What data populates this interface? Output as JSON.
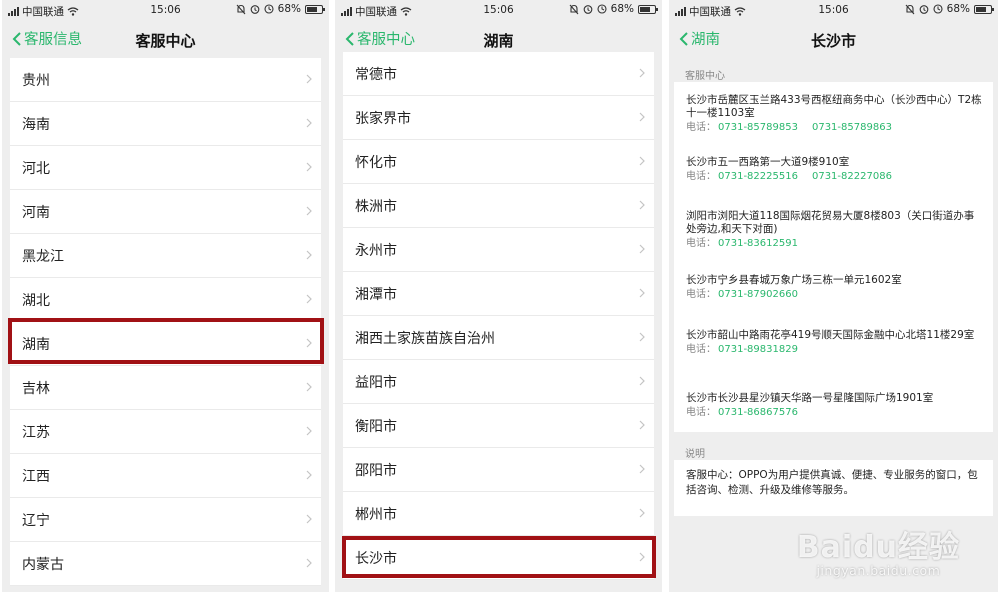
{
  "status": {
    "carrier": "中国联通",
    "time": "15:06",
    "battery": "68%",
    "battery_level": 0.68,
    "icons": [
      "signal-icon",
      "wifi-icon",
      "bell-off-icon",
      "alarm-icon",
      "clock-icon",
      "battery-icon"
    ]
  },
  "screen1": {
    "back_label": "客服信息",
    "title": "客服中心",
    "items": [
      "贵州",
      "海南",
      "河北",
      "河南",
      "黑龙江",
      "湖北",
      "湖南",
      "吉林",
      "江苏",
      "江西",
      "辽宁",
      "内蒙古"
    ],
    "highlighted_item": "湖南"
  },
  "screen2": {
    "back_label": "客服中心",
    "title": "湖南",
    "items": [
      "常德市",
      "张家界市",
      "怀化市",
      "株洲市",
      "永州市",
      "湘潭市",
      "湘西土家族苗族自治州",
      "益阳市",
      "衡阳市",
      "邵阳市",
      "郴州市",
      "长沙市"
    ],
    "highlighted_item": "长沙市"
  },
  "screen3": {
    "back_label": "湖南",
    "title": "长沙市",
    "section_label": "客服中心",
    "phone_prefix": "电话：",
    "entries": [
      {
        "address": "长沙市岳麓区玉兰路433号西枢纽商务中心（长沙西中心）T2栋十一楼1103室",
        "phones": [
          "0731-85789853",
          "0731-85789863"
        ]
      },
      {
        "address": "长沙市五一西路第一大道9楼910室",
        "phones": [
          "0731-82225516",
          "0731-82227086"
        ]
      },
      {
        "address": "浏阳市浏阳大道118国际烟花贸易大厦8楼803（关口街道办事处旁边,和天下对面)",
        "phones": [
          "0731-83612591"
        ]
      },
      {
        "address": "长沙市宁乡县春城万象广场三栋一单元1602室",
        "phones": [
          "0731-87902660"
        ]
      },
      {
        "address": "长沙市韶山中路雨花亭419号顺天国际金融中心北塔11楼29室",
        "phones": [
          "0731-89831829"
        ]
      },
      {
        "address": "长沙市长沙县星沙镇天华路一号星隆国际广场1901室",
        "phones": [
          "0731-86867576"
        ]
      }
    ],
    "note_label": "说明",
    "note_text": "客服中心：OPPO为用户提供真诚、便捷、专业服务的窗口，包括咨询、检测、升级及维修等服务。"
  },
  "watermark": {
    "logo": "Baidu经验",
    "url": "jingyan.baidu.com"
  },
  "colors": {
    "accent": "#2ab76d",
    "highlight": "#a11115",
    "background": "#eeeeee"
  }
}
